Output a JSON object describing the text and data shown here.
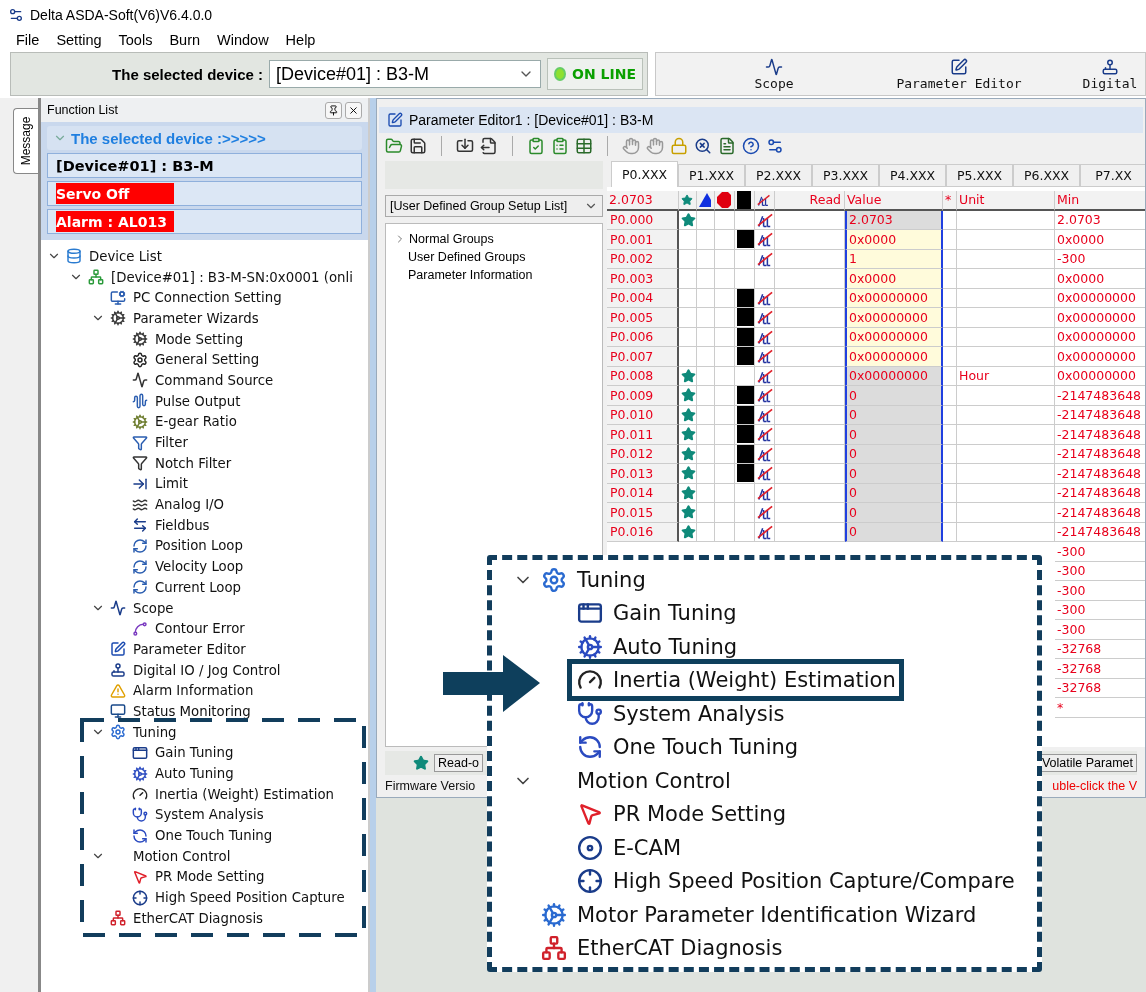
{
  "window": {
    "title": "Delta ASDA-Soft(V6)V6.4.0.0"
  },
  "menu": [
    "File",
    "Setting",
    "Tools",
    "Burn",
    "Window",
    "Help"
  ],
  "device_bar": {
    "label": "The selected device :",
    "device": "[Device#01]  : B3-M",
    "status": "ON LINE",
    "online": true
  },
  "toolbar": [
    {
      "label": "Scope"
    },
    {
      "label": "Parameter Editor"
    },
    {
      "label": "Digital"
    }
  ],
  "side_tab": "Message",
  "function_list": {
    "title": "Function List",
    "header": "The selected device :>>>>>",
    "device": "[Device#01]  : B3-M",
    "status": [
      {
        "text": "Servo Off",
        "alert": true
      },
      {
        "text": "Alarm : AL013",
        "alert": true
      }
    ],
    "tree": [
      {
        "label": "Device List",
        "expanded": true,
        "children": [
          {
            "label": "[Device#01]  : B3-M-SN:0x0001 (onli",
            "expanded": true,
            "children": [
              {
                "label": "PC Connection Setting"
              },
              {
                "label": "Parameter Wizards",
                "expanded": true,
                "children": [
                  {
                    "label": "Mode Setting"
                  },
                  {
                    "label": "General Setting"
                  },
                  {
                    "label": "Command Source"
                  },
                  {
                    "label": "Pulse Output"
                  },
                  {
                    "label": "E-gear Ratio"
                  },
                  {
                    "label": "Filter"
                  },
                  {
                    "label": "Notch Filter"
                  },
                  {
                    "label": "Limit"
                  },
                  {
                    "label": "Analog I/O"
                  },
                  {
                    "label": "Fieldbus"
                  },
                  {
                    "label": "Position Loop"
                  },
                  {
                    "label": "Velocity Loop"
                  },
                  {
                    "label": "Current Loop"
                  }
                ]
              },
              {
                "label": "Scope",
                "expanded": true,
                "children": [
                  {
                    "label": "Contour Error"
                  }
                ]
              },
              {
                "label": "Parameter Editor"
              },
              {
                "label": "Digital IO / Jog Control"
              },
              {
                "label": "Alarm Information"
              },
              {
                "label": "Status Monitoring"
              },
              {
                "label": "Tuning",
                "expanded": true,
                "children": [
                  {
                    "label": "Gain Tuning"
                  },
                  {
                    "label": "Auto Tuning"
                  },
                  {
                    "label": "Inertia (Weight) Estimation"
                  },
                  {
                    "label": "System Analysis"
                  },
                  {
                    "label": "One Touch Tuning"
                  }
                ]
              },
              {
                "label": "Motion Control",
                "expanded": true,
                "children": [
                  {
                    "label": "PR Mode Setting"
                  },
                  {
                    "label": "High Speed Position Capture"
                  }
                ]
              },
              {
                "label": "EtherCAT Diagnosis"
              }
            ]
          }
        ]
      }
    ]
  },
  "parameter_editor": {
    "title": "Parameter Editor1 : [Device#01]  : B3-M",
    "group_select": "[User Defined Group Setup List]",
    "groups": [
      {
        "label": "Normal Groups",
        "expanded": false
      },
      {
        "label": "User Defined Groups"
      },
      {
        "label": "Parameter Information"
      }
    ],
    "tabs": [
      {
        "label": "P0.XXX",
        "selected": true
      },
      {
        "label": "P1.XXX",
        "selected": false
      },
      {
        "label": "P2.XXX",
        "selected": false
      },
      {
        "label": "P3.XXX",
        "selected": false
      },
      {
        "label": "P4.XXX",
        "selected": false
      },
      {
        "label": "P5.XXX",
        "selected": false
      },
      {
        "label": "P6.XXX",
        "selected": false
      },
      {
        "label": "P7.XX",
        "selected": false
      }
    ],
    "columns": [
      "2.0703",
      "Read",
      "Value",
      "*",
      "Unit",
      "Min"
    ],
    "rows": [
      {
        "id": "P0.000",
        "star": true,
        "square": false,
        "crossed": true,
        "editable": false,
        "value": "2.0703",
        "min": "2.0703"
      },
      {
        "id": "P0.001",
        "star": false,
        "square": true,
        "crossed": true,
        "editable": true,
        "value": "0x0000",
        "min": "0x0000"
      },
      {
        "id": "P0.002",
        "star": false,
        "square": false,
        "crossed": true,
        "editable": true,
        "value": "1",
        "min": "-300"
      },
      {
        "id": "P0.003",
        "star": false,
        "square": false,
        "crossed": false,
        "editable": true,
        "value": "0x0000",
        "min": "0x0000"
      },
      {
        "id": "P0.004",
        "star": false,
        "square": true,
        "crossed": true,
        "editable": true,
        "value": "0x00000000",
        "min": "0x00000000"
      },
      {
        "id": "P0.005",
        "star": false,
        "square": true,
        "crossed": true,
        "editable": true,
        "value": "0x00000000",
        "min": "0x00000000"
      },
      {
        "id": "P0.006",
        "star": false,
        "square": true,
        "crossed": true,
        "editable": true,
        "value": "0x00000000",
        "min": "0x00000000"
      },
      {
        "id": "P0.007",
        "star": false,
        "square": true,
        "crossed": true,
        "editable": true,
        "value": "0x00000000",
        "min": "0x00000000"
      },
      {
        "id": "P0.008",
        "star": true,
        "square": false,
        "crossed": true,
        "editable": false,
        "value": "0x00000000",
        "unit": "Hour",
        "min": "0x00000000"
      },
      {
        "id": "P0.009",
        "star": true,
        "square": true,
        "crossed": true,
        "editable": false,
        "value": "0",
        "min": "-2147483648"
      },
      {
        "id": "P0.010",
        "star": true,
        "square": true,
        "crossed": true,
        "editable": false,
        "value": "0",
        "min": "-2147483648"
      },
      {
        "id": "P0.011",
        "star": true,
        "square": true,
        "crossed": true,
        "editable": false,
        "value": "0",
        "min": "-2147483648"
      },
      {
        "id": "P0.012",
        "star": true,
        "square": true,
        "crossed": true,
        "editable": false,
        "value": "0",
        "min": "-2147483648"
      },
      {
        "id": "P0.013",
        "star": true,
        "square": true,
        "crossed": true,
        "editable": false,
        "value": "0",
        "min": "-2147483648"
      },
      {
        "id": "P0.014",
        "star": true,
        "square": false,
        "crossed": true,
        "editable": false,
        "value": "0",
        "min": "-2147483648"
      },
      {
        "id": "P0.015",
        "star": true,
        "square": false,
        "crossed": true,
        "editable": false,
        "value": "0",
        "min": "-2147483648"
      },
      {
        "id": "P0.016",
        "star": true,
        "square": false,
        "crossed": true,
        "editable": false,
        "value": "0",
        "min": "-2147483648"
      },
      {
        "min": "-300"
      },
      {
        "min": "-300"
      },
      {
        "min": "-300"
      },
      {
        "min": "-300"
      },
      {
        "min": "-300"
      },
      {
        "min": "-32768"
      },
      {
        "min": "-32768"
      },
      {
        "min": "-32768"
      },
      {
        "min": "*"
      }
    ],
    "legend": "Read-o",
    "legend_right": "Volatile Paramet",
    "status_left": "Firmware Versio",
    "status_right": "uble-click the V"
  },
  "callout": {
    "tree": [
      {
        "label": "Tuning",
        "expanded": true,
        "children": [
          {
            "label": "Gain Tuning"
          },
          {
            "label": "Auto Tuning"
          },
          {
            "label": "Inertia (Weight) Estimation",
            "highlighted": true
          },
          {
            "label": "System Analysis"
          },
          {
            "label": "One Touch Tuning"
          }
        ]
      },
      {
        "label": "Motion Control",
        "expanded": true,
        "children": [
          {
            "label": "PR Mode Setting"
          },
          {
            "label": "E-CAM"
          },
          {
            "label": "High Speed Position Capture/Compare"
          }
        ]
      },
      {
        "label": "Motor Parameter Identification Wizard"
      },
      {
        "label": "EtherCAT Diagnosis"
      }
    ]
  }
}
